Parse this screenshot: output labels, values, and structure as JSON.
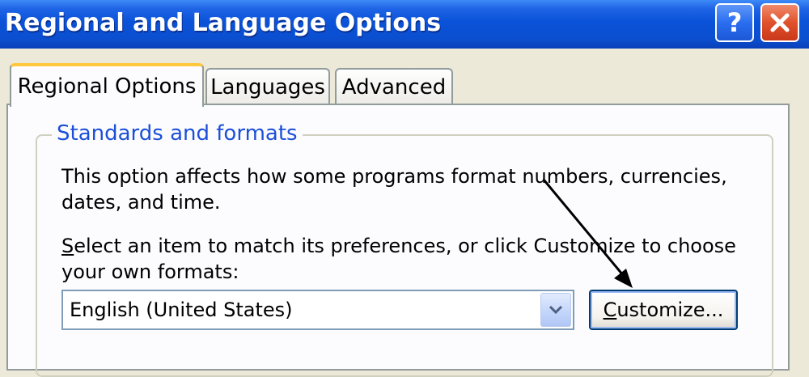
{
  "window": {
    "title": "Regional and Language Options",
    "help_button_label": "?",
    "close_button_icon": "close-icon"
  },
  "tabs": [
    {
      "label": "Regional Options",
      "selected": true
    },
    {
      "label": "Languages",
      "selected": false
    },
    {
      "label": "Advanced",
      "selected": false
    }
  ],
  "standards": {
    "group_title": "Standards and formats",
    "description": "This option affects how some programs format numbers, currencies, dates, and time.",
    "instruction_mnemonic": "S",
    "instruction_rest": "elect an item to match its preferences, or click Customize to choose your own formats:",
    "selected_locale": "English (United States)",
    "customize_mnemonic": "C",
    "customize_rest": "ustomize..."
  },
  "icons": {
    "dropdown": "chevron-down-icon",
    "annotation": "annotation-arrow-icon"
  },
  "colors": {
    "titlebar": "#0a52d8",
    "group_title": "#1c4fd8",
    "close_button": "#e0512c",
    "active_tab_highlight": "#ffc83c"
  }
}
